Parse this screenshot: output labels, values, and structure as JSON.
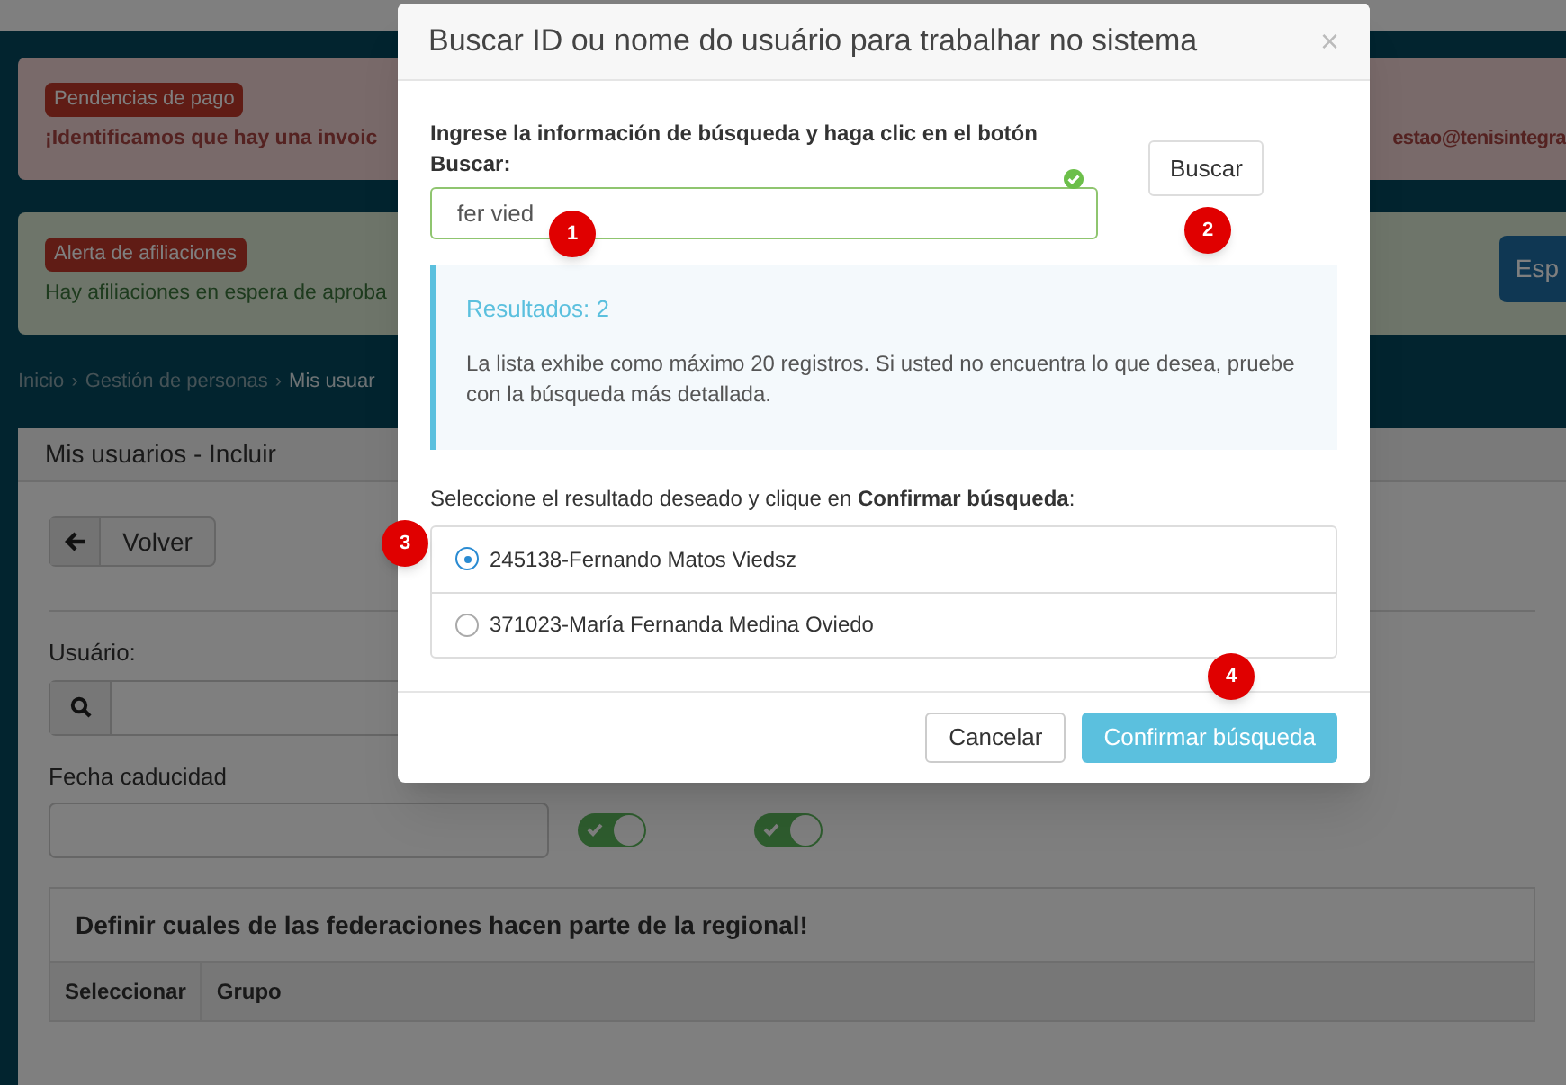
{
  "alerts": [
    {
      "kind": "danger",
      "badge": "Pendencias de pago",
      "text": "¡Identificamos que hay una invoic",
      "text_right": "estao@tenisintegra"
    },
    {
      "kind": "success",
      "badge": "Alerta de afiliaciones",
      "text": "Hay afiliaciones en espera de aproba",
      "button": "Esp"
    }
  ],
  "breadcrumb": [
    "Inicio",
    "Gestión de personas",
    "Mis usuar"
  ],
  "breadcrumb_separator": "›",
  "panel": {
    "title": "Mis usuarios - Incluir",
    "back_button": "Volver",
    "user_label": "Usuário:",
    "date_label": "Fecha caducidad",
    "toggles": [
      {
        "on": true
      },
      {
        "on": true
      }
    ],
    "federations_title": "Definir cuales de las federaciones hacen parte de la regional!",
    "columns": [
      "Seleccionar",
      "Grupo"
    ]
  },
  "modal": {
    "title": "Buscar ID ou nome do usuário para trabalhar no sistema",
    "close": "×",
    "search_label": "Ingrese la información de búsqueda y haga clic en el botón Buscar:",
    "search_value": "fer vied",
    "search_button": "Buscar",
    "results_title": "Resultados: 2",
    "results_text": "La lista exhibe como máximo 20 registros. Si usted no encuentra lo que desea, pruebe con la búsqueda más detallada.",
    "select_label": "Seleccione el resultado deseado y clique en **Confirmar búsqueda**:",
    "results": [
      {
        "label": "245138-Fernando Matos Viedsz",
        "selected": true
      },
      {
        "label": "371023-María Fernanda Medina Oviedo",
        "selected": false
      }
    ],
    "cancel_button": "Cancelar",
    "confirm_button": "Confirmar búsqueda"
  },
  "annotations": [
    "1",
    "2",
    "3",
    "4"
  ]
}
